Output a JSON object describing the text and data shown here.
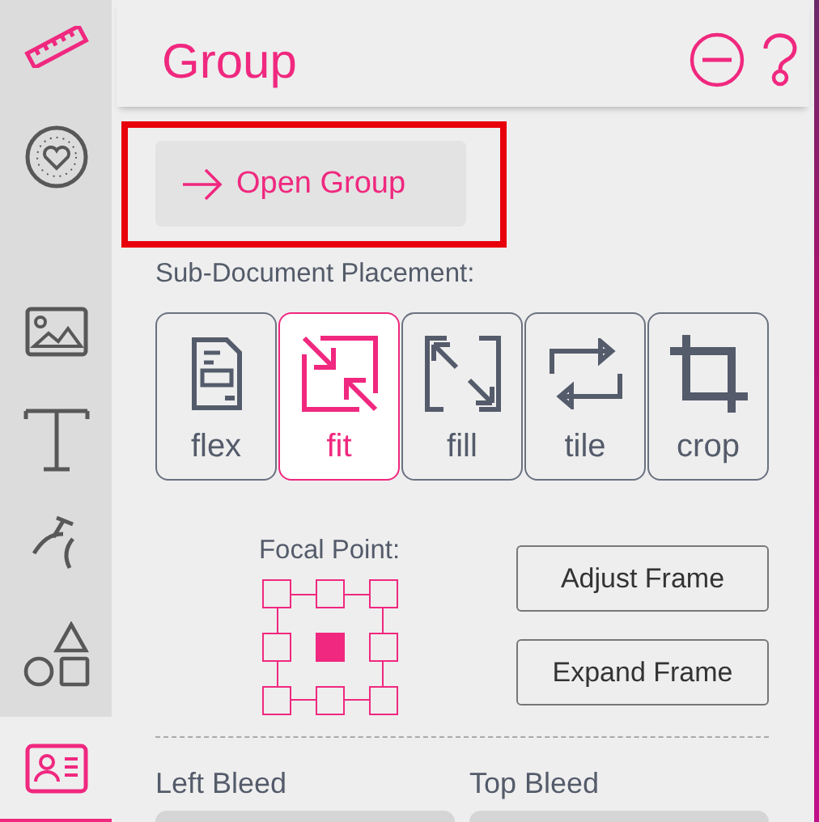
{
  "sidebar": {
    "items": [
      {
        "kind": "ruler",
        "selected": false
      },
      {
        "kind": "badge",
        "selected": false
      },
      {
        "kind": "image",
        "selected": false
      },
      {
        "kind": "text",
        "selected": false
      },
      {
        "kind": "pen",
        "selected": false
      },
      {
        "kind": "shapes",
        "selected": false
      },
      {
        "kind": "card",
        "selected": true
      }
    ]
  },
  "panel": {
    "title": "Group",
    "open_button": {
      "label": "Open Group",
      "highlighted": true
    },
    "placement": {
      "label": "Sub-Document Placement:",
      "options": [
        {
          "kind": "flex",
          "label": "flex",
          "selected": false
        },
        {
          "kind": "fit",
          "label": "fit",
          "selected": true
        },
        {
          "kind": "fill",
          "label": "fill",
          "selected": false
        },
        {
          "kind": "tile",
          "label": "tile",
          "selected": false
        },
        {
          "kind": "crop",
          "label": "crop",
          "selected": false
        }
      ]
    },
    "focal_point": {
      "label": "Focal Point:",
      "cells": [
        {
          "selected": false
        },
        {
          "selected": false
        },
        {
          "selected": false
        },
        {
          "selected": false
        },
        {
          "selected": true
        },
        {
          "selected": false
        },
        {
          "selected": false
        },
        {
          "selected": false
        },
        {
          "selected": false
        }
      ]
    },
    "frame_buttons": [
      "Adjust Frame",
      "Expand Frame"
    ],
    "bleeds": [
      {
        "label": "Left Bleed"
      },
      {
        "label": "Top Bleed"
      }
    ]
  }
}
